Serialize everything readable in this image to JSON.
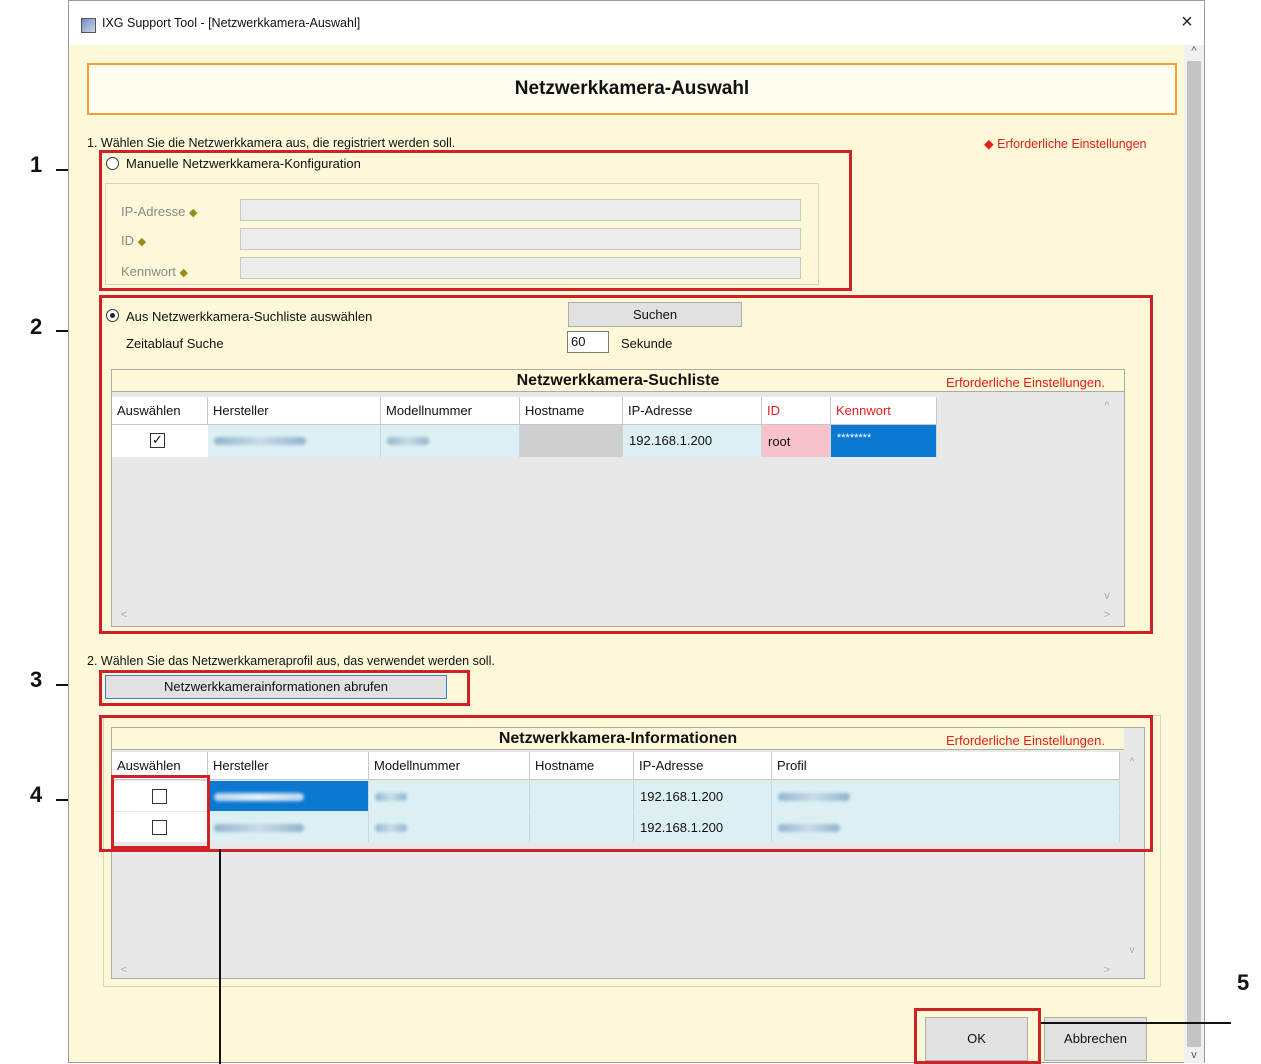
{
  "window": {
    "title": "IXG Support Tool - [Netzwerkkamera-Auswahl]"
  },
  "header": {
    "title": "Netzwerkkamera-Auswahl"
  },
  "step1": {
    "instruction": "1. Wählen Sie die Netzwerkkamera aus, die registriert werden soll.",
    "required_note": "Erforderliche Einstellungen",
    "manual_radio_label": "Manuelle Netzwerkkamera-Konfiguration",
    "ip_label": "IP-Adresse",
    "id_label": "ID",
    "password_label": "Kennwort",
    "ip_value": "",
    "id_value": "",
    "password_value": ""
  },
  "search": {
    "radio_label": "Aus Netzwerkkamera-Suchliste auswählen",
    "search_button": "Suchen",
    "timeout_label": "Zeitablauf Suche",
    "timeout_value": "60",
    "timeout_unit": "Sekunde",
    "list_title": "Netzwerkkamera-Suchliste",
    "list_required": "Erforderliche Einstellungen.",
    "columns": [
      "Auswählen",
      "Hersteller",
      "Modellnummer",
      "Hostname",
      "IP-Adresse",
      "ID",
      "Kennwort"
    ],
    "rows": [
      {
        "selected": true,
        "manufacturer": "",
        "model": "",
        "hostname": "",
        "ip": "192.168.1.200",
        "id": "root",
        "password": "********"
      }
    ]
  },
  "step2": {
    "instruction": "2. Wählen Sie das Netzwerkkameraprofil aus, das verwendet werden soll.",
    "fetch_button": "Netzwerkkamerainformationen abrufen"
  },
  "info": {
    "list_title": "Netzwerkkamera-Informationen",
    "list_required": "Erforderliche Einstellungen.",
    "columns": [
      "Auswählen",
      "Hersteller",
      "Modellnummer",
      "Hostname",
      "IP-Adresse",
      "Profil"
    ],
    "rows": [
      {
        "selected": false,
        "manufacturer": "",
        "model": "",
        "hostname": "",
        "ip": "192.168.1.200",
        "profile": ""
      },
      {
        "selected": false,
        "manufacturer": "",
        "model": "",
        "hostname": "",
        "ip": "192.168.1.200",
        "profile": ""
      }
    ]
  },
  "footer": {
    "ok": "OK",
    "cancel": "Abbrechen"
  },
  "callouts": [
    "1",
    "2",
    "3",
    "4",
    "5"
  ],
  "colors": {
    "callout_box": "#cc2228",
    "required": "#e21d1d",
    "header_border": "#f0a030",
    "background": "#fdf8d8"
  }
}
